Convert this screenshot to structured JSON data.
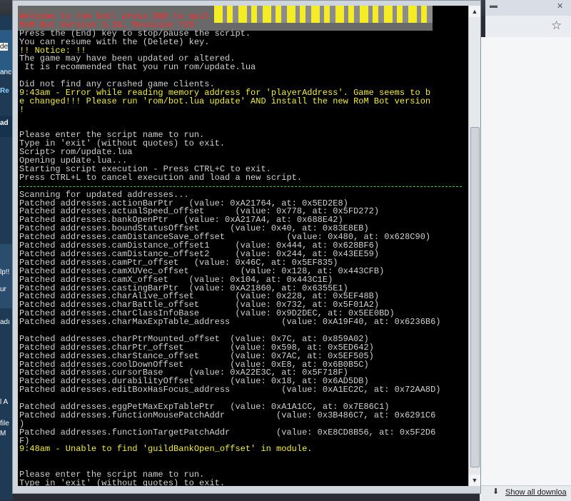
{
  "background": {
    "left_fragments": [
      "de",
      "anc",
      "Re",
      "ad",
      "lp!!",
      "ur",
      "adı",
      "l A",
      "file",
      "M"
    ],
    "download_bar": {
      "link": "Show all downloa"
    }
  },
  "console": {
    "lines": [
      {
        "text": "Welcome to rom bot! press END to quit",
        "color": "red"
      },
      {
        "text": "RoM Bot Version 3.29, Revision 725",
        "color": "red"
      },
      {
        "text": "Press the (End) key to stop/pause the script.",
        "color": "white"
      },
      {
        "text": "You can resume with the (Delete) key.",
        "color": "white"
      },
      {
        "text": "!! Notice: !!",
        "color": "yellow"
      },
      {
        "text": "The game may have been updated or altered.",
        "color": "white"
      },
      {
        "text": " It is recommended that you run rom/update.lua",
        "color": "white"
      },
      {
        "text": "",
        "color": "white"
      },
      {
        "text": "Did not find any crashed game clients.",
        "color": "white"
      },
      {
        "text": "9:43am - Error while reading memory address for 'playerAddress'. Game seems to b",
        "color": "yellow"
      },
      {
        "text": "e changed!!! Please run 'rom/bot.lua update' AND install the new RoM Bot version",
        "color": "yellow"
      },
      {
        "text": "!",
        "color": "yellow"
      },
      {
        "text": "",
        "color": "white"
      },
      {
        "text": "",
        "color": "white"
      },
      {
        "text": "Please enter the script name to run.",
        "color": "white"
      },
      {
        "text": "Type in 'exit' (without quotes) to exit.",
        "color": "white"
      },
      {
        "text": "Script> rom/update.lua",
        "color": "white"
      },
      {
        "text": "Opening update.lua...",
        "color": "white"
      },
      {
        "text": "Starting script execution - Press CTRL+C to exit.",
        "color": "white"
      },
      {
        "text": "Press CTRL+L to cancel execution and load a new script.",
        "color": "white"
      },
      {
        "text": "",
        "color": "divider"
      },
      {
        "text": "Scanning for updated addresses...",
        "color": "white"
      },
      {
        "text": "Patched addresses.actionBarPtr   (value: 0xA21764, at: 0x5ED2E8)",
        "color": "white"
      },
      {
        "text": "Patched addresses.actualSpeed_offset      (value: 0x778, at: 0x5FD272)",
        "color": "white"
      },
      {
        "text": "Patched addresses.bankOpenPtr   (value: 0xA217A4, at: 0x688E42)",
        "color": "white"
      },
      {
        "text": "Patched addresses.boundStatusOffset      (value: 0x40, at: 0x83E8EB)",
        "color": "white"
      },
      {
        "text": "Patched addresses.camDistanceSave_offset            (value: 0x480, at: 0x628C90)",
        "color": "white"
      },
      {
        "text": "Patched addresses.camDistance_offset1     (value: 0x444, at: 0x628BF6)",
        "color": "white"
      },
      {
        "text": "Patched addresses.camDistance_offset2     (value: 0x244, at: 0x43EE59)",
        "color": "white"
      },
      {
        "text": "Patched addresses.camPtr_offset   (value: 0x46C, at: 0x5EF835)",
        "color": "white"
      },
      {
        "text": "Patched addresses.camXUVec_offset          (value: 0x128, at: 0x443CFB)",
        "color": "white"
      },
      {
        "text": "Patched addresses.camX_offset    (value: 0x104, at: 0x443C1E)",
        "color": "white"
      },
      {
        "text": "Patched addresses.castingBarPtr  (value: 0xA21860, at: 0x6355E1)",
        "color": "white"
      },
      {
        "text": "Patched addresses.charAlive_offset        (value: 0x228, at: 0x5EF48B)",
        "color": "white"
      },
      {
        "text": "Patched addresses.charBattle_offset       (value: 0x732, at: 0x5F01A2)",
        "color": "white"
      },
      {
        "text": "Patched addresses.charClassInfoBase       (value: 0x9D2DEC, at: 0x5EE0BD)",
        "color": "white"
      },
      {
        "text": "Patched addresses.charMaxExpTable_address          (value: 0xA19F40, at: 0x6236B6)",
        "color": "white"
      },
      {
        "text": "",
        "color": "white"
      },
      {
        "text": "Patched addresses.charPtrMounted_offset  (value: 0x7C, at: 0x859A02)",
        "color": "white"
      },
      {
        "text": "Patched addresses.charPtr_offset         (value: 0x598, at: 0x5ED642)",
        "color": "white"
      },
      {
        "text": "Patched addresses.charStance_offset      (value: 0x7AC, at: 0x5EF505)",
        "color": "white"
      },
      {
        "text": "Patched addresses.coolDownOffset         (value: 0xE8, at: 0x6B0B5C)",
        "color": "white"
      },
      {
        "text": "Patched addresses.cursorBase     (value: 0xA22E3C, at: 0x5F718F)",
        "color": "white"
      },
      {
        "text": "Patched addresses.durabilityOffset       (value: 0x18, at: 0x6AD5DB)",
        "color": "white"
      },
      {
        "text": "Patched addresses.editBoxHasFocus_address          (value: 0xA1EC2C, at: 0x72AA8D)",
        "color": "white"
      },
      {
        "text": "",
        "color": "white"
      },
      {
        "text": "Patched addresses.eggPetMaxExpTablePtr   (value: 0xA1A1CC, at: 0x7E86C1)",
        "color": "white"
      },
      {
        "text": "Patched addresses.functionMousePatchAddr          (value: 0x3B486C7, at: 0x6291C6",
        "color": "white"
      },
      {
        "text": ")",
        "color": "white"
      },
      {
        "text": "Patched addresses.functionTargetPatchAddr         (value: 0xE8CD8B56, at: 0x5F2D6",
        "color": "white"
      },
      {
        "text": "F)",
        "color": "white"
      },
      {
        "text": "9:48am - Unable to find 'guildBankOpen_offset' in module.",
        "color": "yellow"
      },
      {
        "text": "",
        "color": "white"
      },
      {
        "text": "",
        "color": "white"
      },
      {
        "text": "Please enter the script name to run.",
        "color": "white"
      },
      {
        "text": "Type in 'exit' (without quotes) to exit.",
        "color": "white"
      }
    ]
  }
}
